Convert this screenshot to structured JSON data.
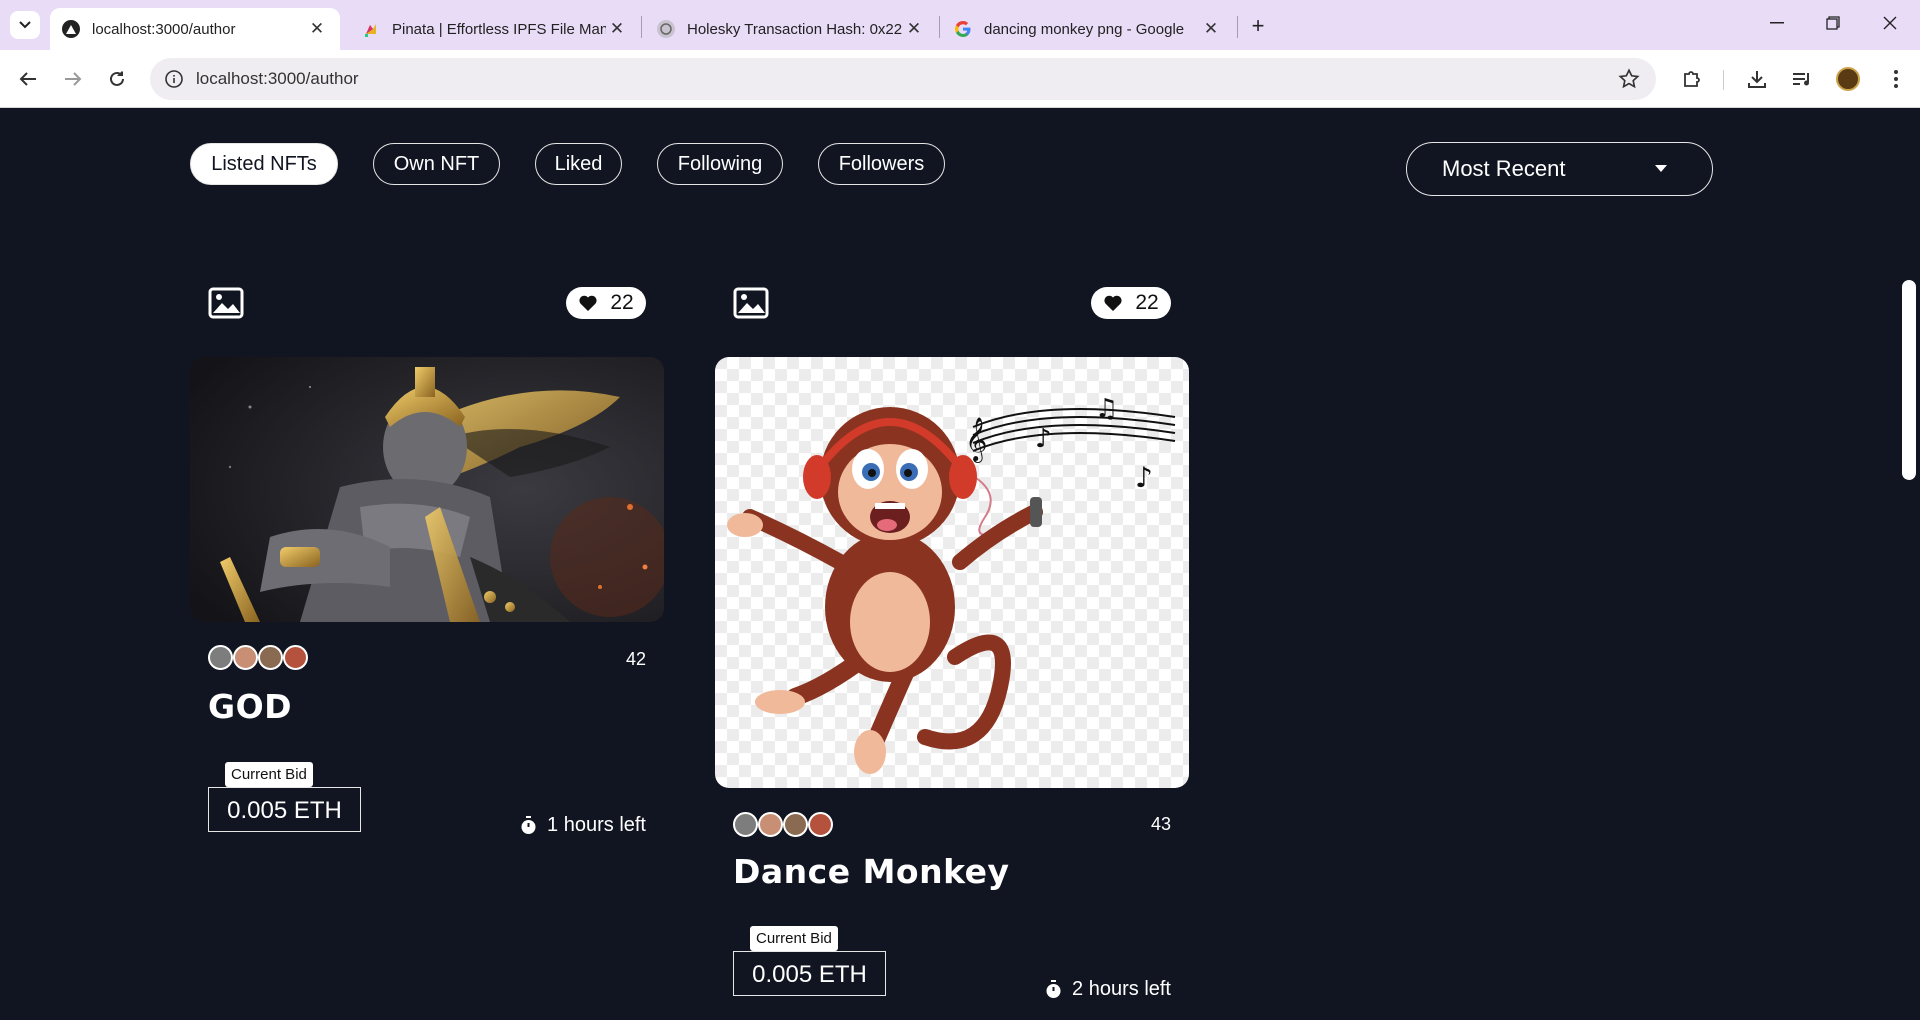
{
  "browser": {
    "tabs": [
      {
        "title": "localhost:3000/author",
        "active": true,
        "favicon": "triangle-icon"
      },
      {
        "title": "Pinata | Effortless IPFS File Man",
        "active": false,
        "favicon": "pinata-icon"
      },
      {
        "title": "Holesky Transaction Hash: 0x22",
        "active": false,
        "favicon": "etherscan-icon"
      },
      {
        "title": "dancing monkey png - Google",
        "active": false,
        "favicon": "google-icon"
      }
    ],
    "url": "localhost:3000/author"
  },
  "filters": [
    {
      "label": "Listed NFTs",
      "active": true
    },
    {
      "label": "Own NFT",
      "active": false
    },
    {
      "label": "Liked",
      "active": false
    },
    {
      "label": "Following",
      "active": false
    },
    {
      "label": "Followers",
      "active": false
    }
  ],
  "sort": {
    "selected": "Most Recent"
  },
  "cards": [
    {
      "likes": "22",
      "count": "42",
      "title": "GOD",
      "bid_label": "Current Bid",
      "bid": "0.005 ETH",
      "time_left": "1 hours left",
      "image": "hanuman-artwork"
    },
    {
      "likes": "22",
      "count": "43",
      "title": "Dance Monkey",
      "bid_label": "Current Bid",
      "bid": "0.005 ETH",
      "time_left": "2 hours left",
      "image": "dancing-monkey-artwork"
    }
  ],
  "colors": {
    "page_bg": "#111521",
    "tabbar_bg": "#e9dcf7",
    "accent_white": "#ffffff"
  }
}
